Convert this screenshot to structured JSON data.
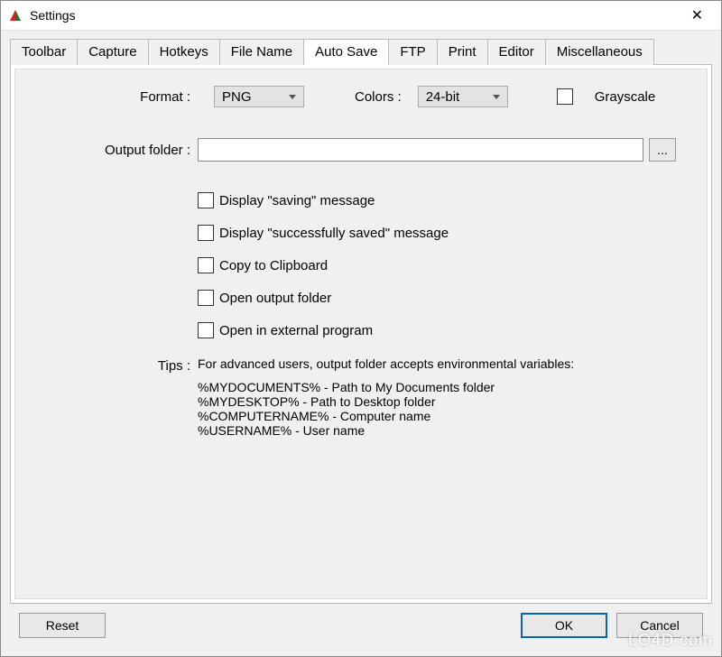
{
  "window": {
    "title": "Settings"
  },
  "tabs": [
    "Toolbar",
    "Capture",
    "Hotkeys",
    "File Name",
    "Auto Save",
    "FTP",
    "Print",
    "Editor",
    "Miscellaneous"
  ],
  "active_tab_index": 4,
  "labels": {
    "format": "Format :",
    "colors": "Colors :",
    "grayscale": "Grayscale",
    "output_folder": "Output folder :",
    "tips": "Tips :",
    "browse": "..."
  },
  "dropdowns": {
    "format_value": "PNG",
    "colors_value": "24-bit"
  },
  "output_folder": {
    "value": ""
  },
  "checkboxes": {
    "display_saving": "Display \"saving\" message",
    "display_saved": "Display \"successfully saved\" message",
    "copy_clipboard": "Copy to Clipboard",
    "open_output": "Open output folder",
    "open_external": "Open in external program"
  },
  "tips": {
    "intro": "For advanced users, output folder accepts environmental variables:",
    "lines": [
      "%MYDOCUMENTS% - Path to My Documents folder",
      "%MYDESKTOP% - Path to Desktop folder",
      "%COMPUTERNAME% - Computer name",
      "%USERNAME% - User name"
    ]
  },
  "buttons": {
    "reset": "Reset",
    "ok": "OK",
    "cancel": "Cancel"
  },
  "watermark": "LO4D.com"
}
